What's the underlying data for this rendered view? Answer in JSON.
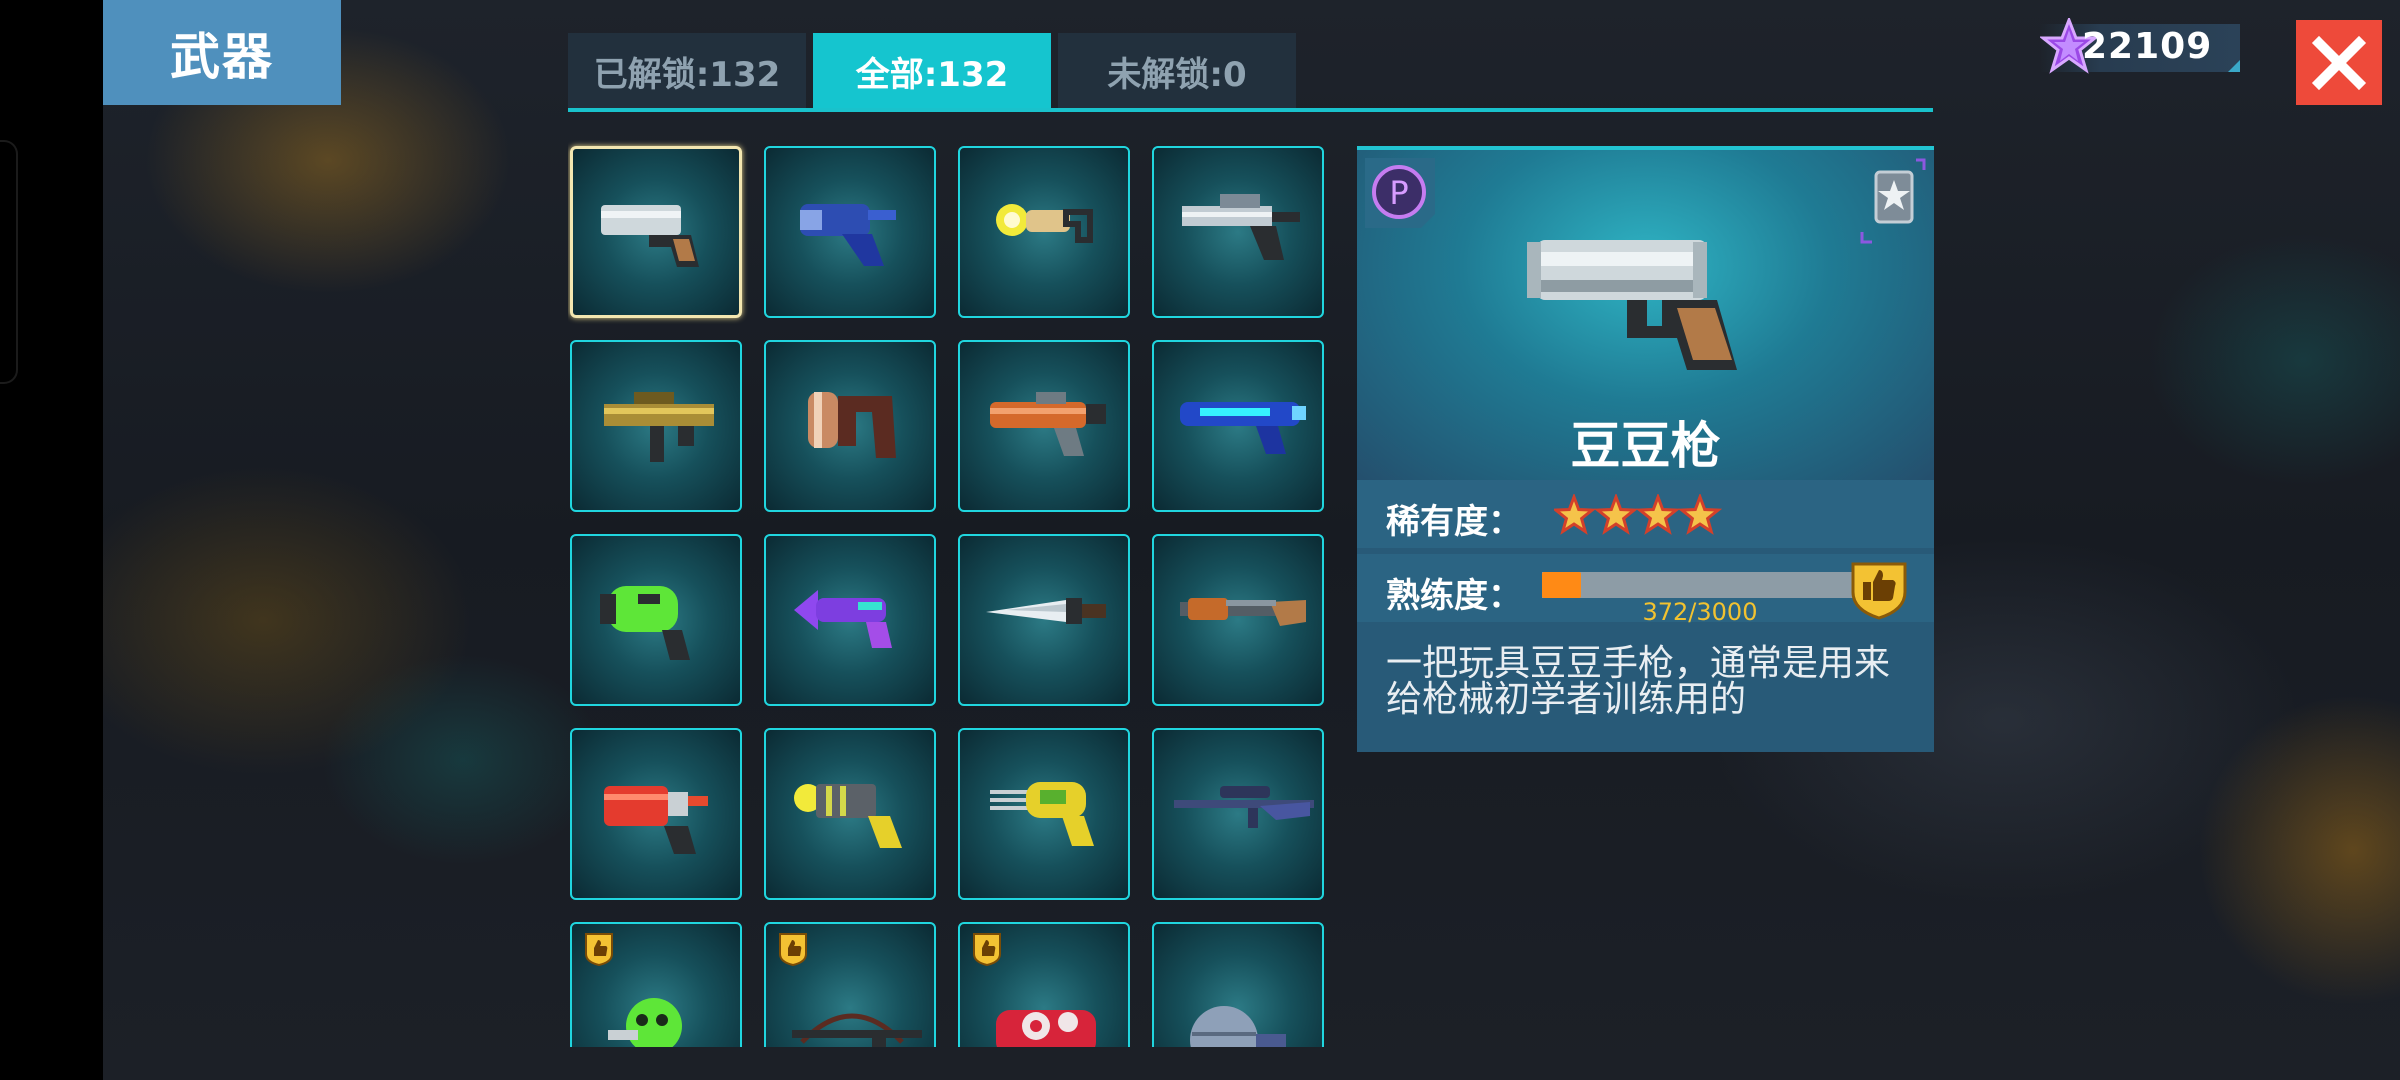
{
  "header": {
    "title": "武器",
    "tabs": [
      {
        "label": "已解锁:132",
        "active": false
      },
      {
        "label": "全部:132",
        "active": true
      },
      {
        "label": "未解锁:0",
        "active": false
      }
    ],
    "currency": {
      "value": "22109",
      "icon": "purple-star-icon"
    },
    "close_icon": "close-icon"
  },
  "weapons": [
    {
      "name": "bean-gun",
      "selected": true
    },
    {
      "name": "blue-blaster"
    },
    {
      "name": "yellow-ray-gun"
    },
    {
      "name": "silver-pistol"
    },
    {
      "name": "gold-smg"
    },
    {
      "name": "copper-cannon"
    },
    {
      "name": "orange-blaster"
    },
    {
      "name": "blue-plasma-rifle"
    },
    {
      "name": "green-toxic-gun"
    },
    {
      "name": "purple-laser-gun"
    },
    {
      "name": "knife"
    },
    {
      "name": "shotgun"
    },
    {
      "name": "red-canister-gun"
    },
    {
      "name": "yellow-battery-gun"
    },
    {
      "name": "yellow-sonic-gun"
    },
    {
      "name": "sniper-rifle"
    },
    {
      "name": "green-skull-gun",
      "badge": "thumb-badge-icon"
    },
    {
      "name": "crossbow",
      "badge": "thumb-badge-icon"
    },
    {
      "name": "red-eye-gun",
      "badge": "thumb-badge-icon"
    },
    {
      "name": "sphere-launcher"
    }
  ],
  "detail": {
    "name": "豆豆枪",
    "rarity_label": "稀有度：",
    "rarity_stars": 4,
    "mastery_label": "熟练度：",
    "mastery_current": 372,
    "mastery_max": 3000,
    "mastery_text": "372/3000",
    "description": "一把玩具豆豆手枪，通常是用来给枪械初学者训练用的",
    "p_badge": "P",
    "colors": {
      "accent": "#15c5cf",
      "mastery_fill": "#ff8a15",
      "star": "#f5c34a",
      "close": "#ee4a3a"
    }
  }
}
